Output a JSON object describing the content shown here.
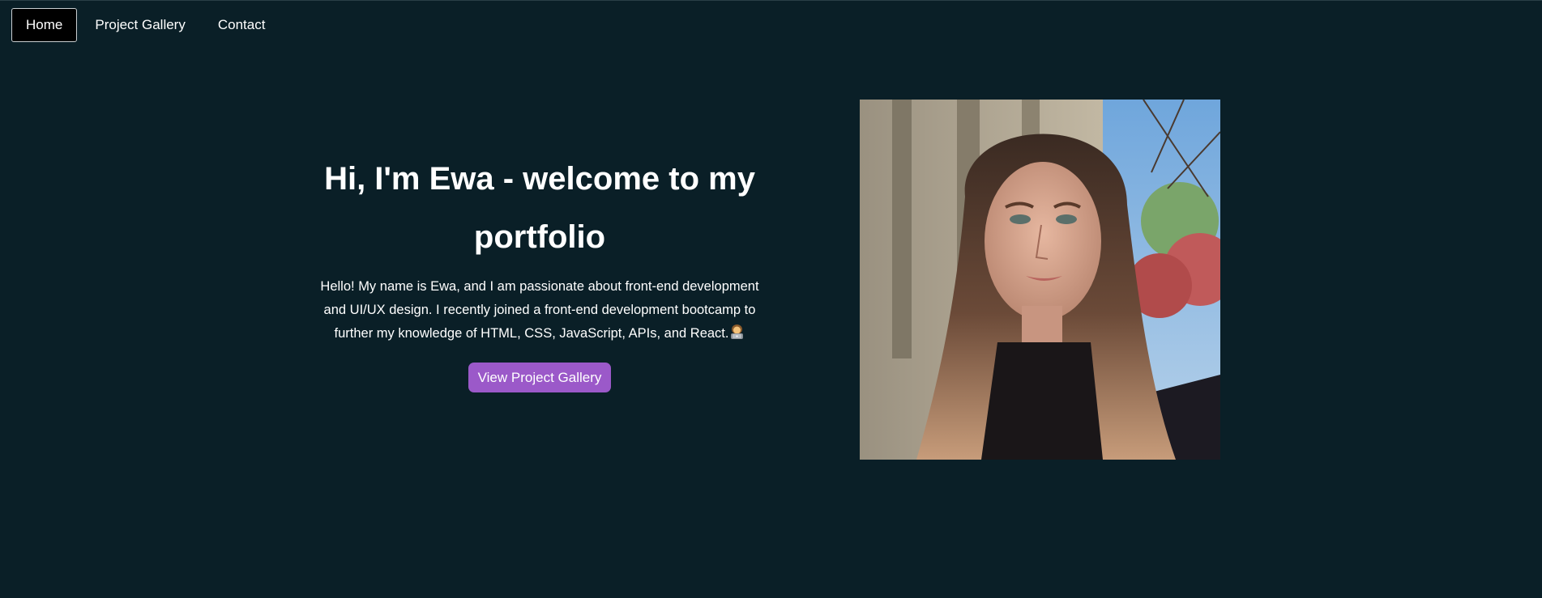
{
  "nav": {
    "items": [
      {
        "label": "Home",
        "active": true
      },
      {
        "label": "Project Gallery",
        "active": false
      },
      {
        "label": "Contact",
        "active": false
      }
    ]
  },
  "hero": {
    "title": "Hi, I'm Ewa - welcome to my portfolio",
    "description": "Hello! My name is Ewa, and I am passionate about front-end development and UI/UX design. I recently joined a front-end development bootcamp to further my knowledge of HTML, CSS, JavaScript, APIs, and React.",
    "emoji_icon": "woman-technologist-emoji",
    "cta_label": "View Project Gallery"
  },
  "colors": {
    "background": "#0a1f27",
    "accent": "#9b59c9",
    "active_nav_bg": "#000000"
  },
  "portrait": {
    "icon": "profile-photo"
  }
}
